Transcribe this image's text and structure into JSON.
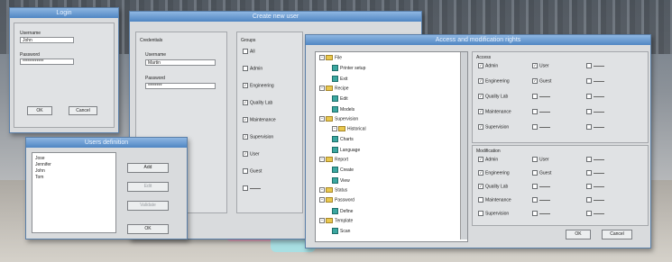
{
  "colors": {
    "titlebar": "#4f86c3",
    "window_bg": "#d9dbdd"
  },
  "login": {
    "title": "Login",
    "username_label": "Username",
    "username_value": "John",
    "password_label": "Password",
    "password_value": "************",
    "ok": "OK",
    "cancel": "Cancel"
  },
  "users": {
    "title": "Users definition",
    "list": [
      "Jose",
      "Jennifer",
      "John",
      "Tom"
    ],
    "add": "Add",
    "edit": "Edit",
    "validate": "Validate",
    "ok": "OK"
  },
  "create": {
    "title": "Create new user",
    "credentials_label": "Credentials",
    "username_label": "Username",
    "username_value": "Martin",
    "password_label": "Password",
    "password_value": "********",
    "groups_label": "Groups",
    "groups": [
      {
        "name": "All",
        "checked": false
      },
      {
        "name": "Admin",
        "checked": false
      },
      {
        "name": "Engineering",
        "checked": true
      },
      {
        "name": "Quality Lab",
        "checked": true
      },
      {
        "name": "Maintenance",
        "checked": true
      },
      {
        "name": "Supervision",
        "checked": true
      },
      {
        "name": "User",
        "checked": true
      },
      {
        "name": "Guest",
        "checked": false
      },
      {
        "name": "",
        "checked": false
      }
    ]
  },
  "access": {
    "title": "Access and modification rights",
    "tree": [
      {
        "label": "File",
        "level": 0,
        "type": "folder"
      },
      {
        "label": "Printer setup",
        "level": 1,
        "type": "doc"
      },
      {
        "label": "Exit",
        "level": 1,
        "type": "doc"
      },
      {
        "label": "Recipe",
        "level": 0,
        "type": "folder"
      },
      {
        "label": "Edit",
        "level": 1,
        "type": "doc"
      },
      {
        "label": "Models",
        "level": 1,
        "type": "doc"
      },
      {
        "label": "Supervision",
        "level": 0,
        "type": "folder"
      },
      {
        "label": "Historical",
        "level": 1,
        "type": "folder"
      },
      {
        "label": "Charts",
        "level": 1,
        "type": "doc"
      },
      {
        "label": "Language",
        "level": 1,
        "type": "doc"
      },
      {
        "label": "Report",
        "level": 0,
        "type": "folder"
      },
      {
        "label": "Create",
        "level": 1,
        "type": "doc"
      },
      {
        "label": "View",
        "level": 1,
        "type": "doc"
      },
      {
        "label": "Status",
        "level": 0,
        "type": "folder"
      },
      {
        "label": "Password",
        "level": 0,
        "type": "folder"
      },
      {
        "label": "Define",
        "level": 1,
        "type": "doc"
      },
      {
        "label": "Template",
        "level": 0,
        "type": "folder"
      },
      {
        "label": "Scan",
        "level": 1,
        "type": "doc"
      }
    ],
    "access_label": "Access",
    "access_items": [
      {
        "name": "Admin",
        "checked": true
      },
      {
        "name": "User",
        "checked": true
      },
      {
        "name": "",
        "checked": false
      },
      {
        "name": "Engineering",
        "checked": true
      },
      {
        "name": "Guest",
        "checked": true
      },
      {
        "name": "",
        "checked": false
      },
      {
        "name": "Quality Lab",
        "checked": true
      },
      {
        "name": "",
        "checked": false
      },
      {
        "name": "",
        "checked": false
      },
      {
        "name": "Maintenance",
        "checked": true
      },
      {
        "name": "",
        "checked": false
      },
      {
        "name": "",
        "checked": false
      },
      {
        "name": "Supervision",
        "checked": true
      },
      {
        "name": "",
        "checked": false
      },
      {
        "name": "",
        "checked": false
      }
    ],
    "modification_label": "Modification",
    "mod_items": [
      {
        "name": "Admin",
        "checked": true
      },
      {
        "name": "User",
        "checked": false
      },
      {
        "name": "",
        "checked": false
      },
      {
        "name": "Engineering",
        "checked": true
      },
      {
        "name": "Guest",
        "checked": false
      },
      {
        "name": "",
        "checked": false
      },
      {
        "name": "Quality Lab",
        "checked": true
      },
      {
        "name": "",
        "checked": false
      },
      {
        "name": "",
        "checked": false
      },
      {
        "name": "Maintenance",
        "checked": false
      },
      {
        "name": "",
        "checked": false
      },
      {
        "name": "",
        "checked": false
      },
      {
        "name": "Supervision",
        "checked": false
      },
      {
        "name": "",
        "checked": false
      },
      {
        "name": "",
        "checked": false
      }
    ],
    "ok": "OK",
    "cancel": "Cancel"
  }
}
